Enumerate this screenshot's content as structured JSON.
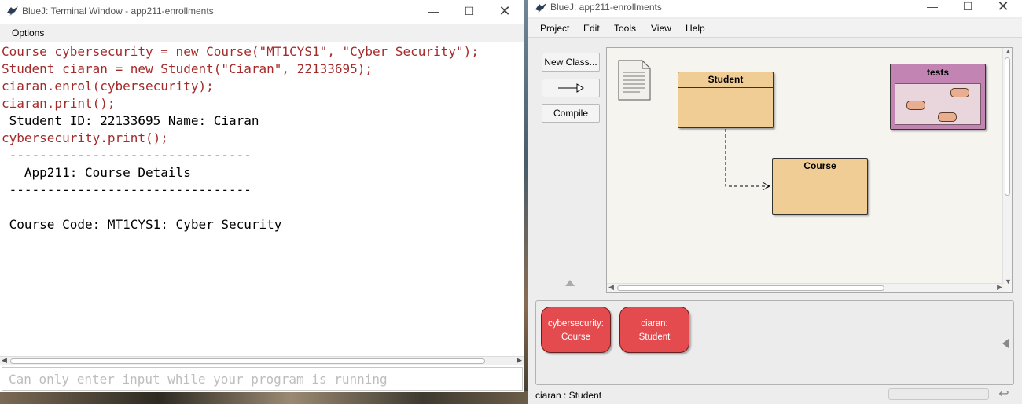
{
  "terminal": {
    "title": "BlueJ: Terminal Window - app211-enrollments",
    "menu": {
      "options": "Options"
    },
    "lines": [
      {
        "kind": "cmd",
        "text": "Course cybersecurity = new Course(\"MT1CYS1\", \"Cyber Security\");"
      },
      {
        "kind": "cmd",
        "text": "Student ciaran = new Student(\"Ciaran\", 22133695);"
      },
      {
        "kind": "cmd",
        "text": "ciaran.enrol(cybersecurity);"
      },
      {
        "kind": "cmd",
        "text": "ciaran.print();"
      },
      {
        "kind": "out",
        "text": " Student ID: 22133695 Name: Ciaran"
      },
      {
        "kind": "cmd",
        "text": "cybersecurity.print();"
      },
      {
        "kind": "out",
        "text": " --------------------------------"
      },
      {
        "kind": "out",
        "text": "   App211: Course Details"
      },
      {
        "kind": "out",
        "text": " --------------------------------"
      },
      {
        "kind": "out",
        "text": ""
      },
      {
        "kind": "out",
        "text": " Course Code: MT1CYS1: Cyber Security"
      }
    ],
    "input_placeholder": "Can only enter input while your program is running"
  },
  "bluej": {
    "title": "BlueJ:  app211-enrollments",
    "menu": [
      "Project",
      "Edit",
      "Tools",
      "View",
      "Help"
    ],
    "sidebar": {
      "new_class": "New Class...",
      "compile": "Compile"
    },
    "classes": {
      "student": "Student",
      "course": "Course",
      "tests_package": "tests"
    },
    "objects": [
      {
        "line1": "cybersecurity:",
        "line2": "Course"
      },
      {
        "line1": "ciaran:",
        "line2": "Student"
      }
    ],
    "status": "ciaran : Student"
  },
  "colors": {
    "command": "#a52a2a",
    "class_fill": "#f1cd96",
    "package_fill": "#c285b3",
    "object_fill": "#e34b4f"
  },
  "icons": {
    "app_logo": "bluej-bird-icon",
    "readme": "document-icon"
  }
}
